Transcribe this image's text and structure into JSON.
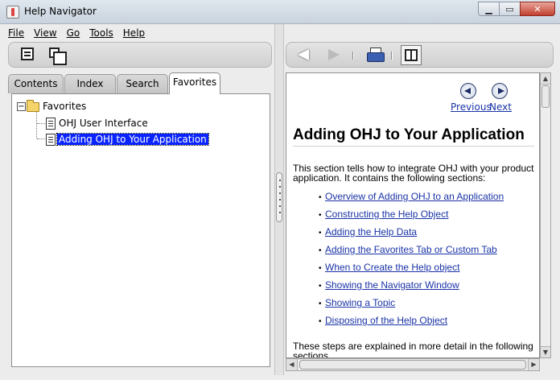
{
  "window": {
    "title": "Help Navigator"
  },
  "menu": {
    "items": [
      "File",
      "View",
      "Go",
      "Tools",
      "Help"
    ]
  },
  "tabs": [
    {
      "label": "Contents",
      "active": false
    },
    {
      "label": "Index",
      "active": false
    },
    {
      "label": "Search",
      "active": false
    },
    {
      "label": "Favorites",
      "active": true
    }
  ],
  "tree": {
    "root": "Favorites",
    "children": [
      {
        "label": "OHJ User Interface",
        "selected": false
      },
      {
        "label": "Adding OHJ to Your Application",
        "selected": true
      }
    ]
  },
  "content": {
    "prev_label": "Previous",
    "next_label": "Next",
    "heading": "Adding OHJ to Your Application",
    "intro": "This section tells how to integrate OHJ with your product application. It contains the following sections:",
    "links": [
      "Overview of Adding OHJ to an Application",
      "Constructing the Help Object",
      "Adding the Help Data",
      "Adding the Favorites Tab or Custom Tab",
      "When to Create the Help object",
      "Showing the Navigator Window",
      "Showing a Topic",
      "Disposing of the Help Object"
    ],
    "footer": "These steps are explained in more detail in the following sections."
  },
  "colors": {
    "selection": "#0a24ff",
    "link": "#1a33a6"
  }
}
